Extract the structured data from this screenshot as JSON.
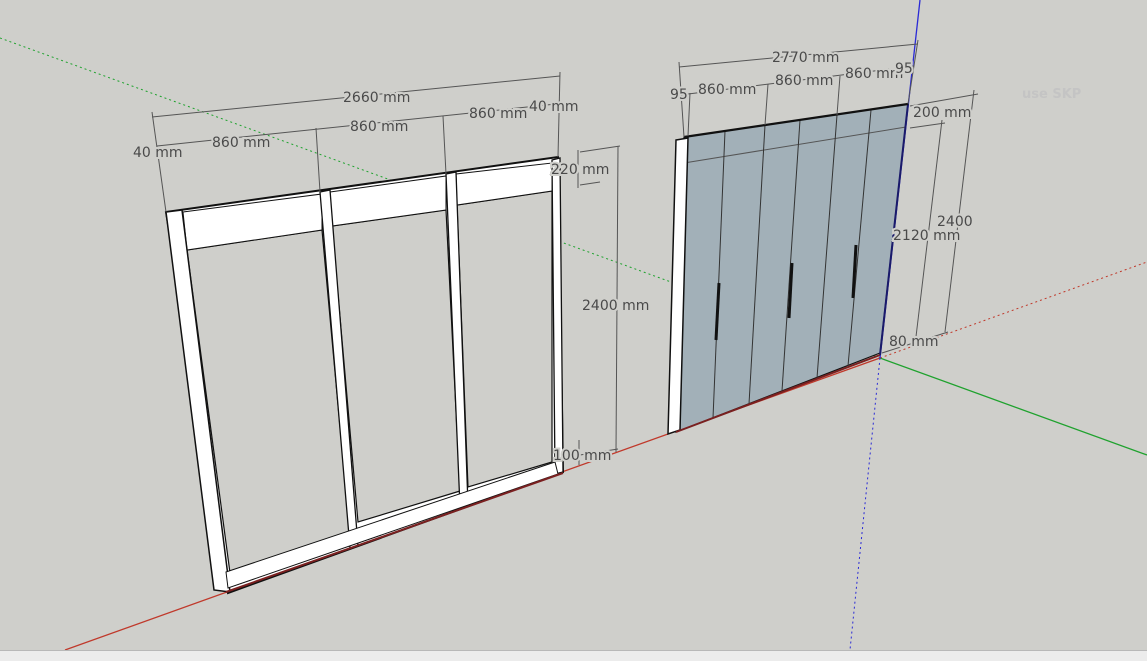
{
  "app": {
    "watermark": "use SKP"
  },
  "colors": {
    "background": "#cfcfcb",
    "axis_red": "#c0392b",
    "axis_green": "#1fa22e",
    "axis_blue": "#2a2ad6",
    "glass": "#a2b0b8",
    "frame_white": "#ffffff",
    "edge": "#111111"
  },
  "frame_model": {
    "dims": {
      "total_width": "2660 mm",
      "left_post": "40 mm",
      "panel_1": "860 mm",
      "panel_2": "860 mm",
      "panel_3": "860 mm",
      "right_post": "40 mm",
      "top_rail": "220 mm",
      "height": "2400 mm",
      "bottom_rail": "100 mm"
    }
  },
  "door_model": {
    "dims": {
      "total_width": "2770 mm",
      "left_stile": "95",
      "panel_1": "860 mm",
      "panel_2": "860 mm",
      "panel_3": "860 mm",
      "right_stile": "95",
      "top_rail": "200 mm",
      "height": "2400",
      "glass_height": "2120 mm",
      "bottom_rail": "80 mm"
    }
  }
}
